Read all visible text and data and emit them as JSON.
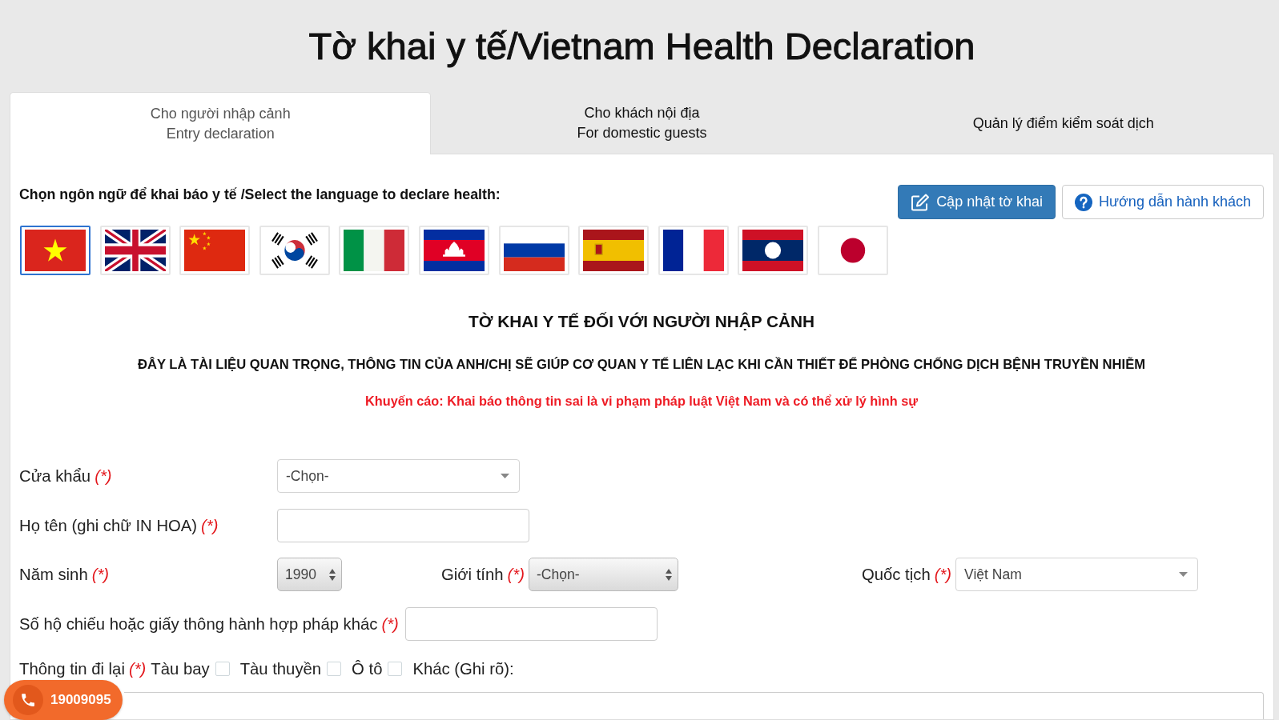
{
  "page_title": "Tờ khai y tế/Vietnam Health Declaration",
  "tabs": [
    {
      "lines": [
        "Cho người nhập cảnh",
        "Entry declaration"
      ],
      "selected": true
    },
    {
      "lines": [
        "Cho khách nội địa",
        "For domestic guests"
      ],
      "selected": false
    },
    {
      "lines": [
        "Quản lý điểm kiểm soát dịch"
      ],
      "selected": false
    }
  ],
  "language_prompt": "Chọn ngôn ngữ để khai báo y tế /Select the language to declare health:",
  "language_flags": [
    {
      "kind": "vietnam",
      "selected": true
    },
    {
      "kind": "uk",
      "selected": false
    },
    {
      "kind": "china",
      "selected": false
    },
    {
      "kind": "korea",
      "selected": false
    },
    {
      "kind": "italy",
      "selected": false
    },
    {
      "kind": "cambodia",
      "selected": false
    },
    {
      "kind": "russia",
      "selected": false
    },
    {
      "kind": "spain",
      "selected": false
    },
    {
      "kind": "france",
      "selected": false
    },
    {
      "kind": "laos",
      "selected": false
    },
    {
      "kind": "japan",
      "selected": false
    }
  ],
  "action_buttons": [
    {
      "kind": "edit",
      "label": "Cập nhật tờ khai"
    },
    {
      "kind": "help",
      "label": "Hướng dẫn hành khách"
    }
  ],
  "form_title": "TỜ KHAI Y TẾ ĐỐI VỚI NGƯỜI NHẬP CẢNH",
  "notice": "ĐÂY LÀ TÀI LIỆU QUAN TRỌNG, THÔNG TIN CỦA ANH/CHỊ SẼ GIÚP CƠ QUAN Y TẾ LIÊN LẠC KHI CẦN THIẾT ĐỂ PHÒNG CHỐNG DỊCH BỆNH TRUYỀN NHIỄM",
  "warning": "Khuyến cáo: Khai báo thông tin sai là vi phạm pháp luật Việt Nam và có thể xử lý hình sự",
  "form_rows": [
    [
      {
        "label": "Cửa khẩu",
        "required_mark": "(*)",
        "kind": "dropdown",
        "value": "-Chọn-"
      }
    ],
    [
      {
        "label": "Họ tên (ghi chữ IN HOA)",
        "required_mark": "(*)",
        "kind": "text"
      }
    ],
    [
      {
        "label": "Năm sinh",
        "required_mark": "(*)",
        "kind": "popup",
        "value": "1990"
      },
      {
        "label": "Giới tính",
        "required_mark": "(*)",
        "kind": "popup",
        "value": "-Chọn-"
      },
      {
        "label": "Quốc tịch",
        "required_mark": "(*)",
        "kind": "dropdown",
        "value": "Việt Nam"
      }
    ],
    [
      {
        "label": "Số hộ chiếu hoặc giấy thông hành hợp pháp khác",
        "required_mark": "(*)",
        "kind": "text"
      }
    ]
  ],
  "travel": {
    "label": "Thông tin đi lại",
    "required_mark": "(*)",
    "options": [
      {
        "label": "Tàu bay",
        "checked": false
      },
      {
        "label": "Tàu thuyền",
        "checked": false
      },
      {
        "label": "Ô tô",
        "checked": false
      }
    ],
    "other_label": "Khác (Ghi rõ):"
  },
  "hotline": {
    "number": "19009095"
  }
}
